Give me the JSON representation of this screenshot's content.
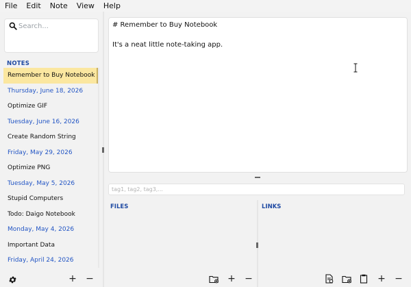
{
  "menu": [
    "File",
    "Edit",
    "Note",
    "View",
    "Help"
  ],
  "search": {
    "placeholder": "Search..."
  },
  "notes_heading": "NOTES",
  "notes": [
    {
      "label": "Remember to Buy Notebook",
      "kind": "selected"
    },
    {
      "label": "Thursday, June 18, 2026",
      "kind": "date"
    },
    {
      "label": "Optimize GIF",
      "kind": "note"
    },
    {
      "label": "Tuesday, June 16, 2026",
      "kind": "date"
    },
    {
      "label": "Create Random String",
      "kind": "note"
    },
    {
      "label": "Friday, May 29, 2026",
      "kind": "date"
    },
    {
      "label": "Optimize PNG",
      "kind": "note"
    },
    {
      "label": "Tuesday, May 5, 2026",
      "kind": "date"
    },
    {
      "label": "Stupid Computers",
      "kind": "note"
    },
    {
      "label": "Todo: Daigo Notebook",
      "kind": "note"
    },
    {
      "label": "Monday, May 4, 2026",
      "kind": "date"
    },
    {
      "label": "Important Data",
      "kind": "note"
    },
    {
      "label": "Friday, April 24, 2026",
      "kind": "date"
    }
  ],
  "editor": {
    "line1": "# Remember to Buy Notebook",
    "line2": "It's a neat little note-taking app."
  },
  "tags": {
    "placeholder": "tag1, tag2, tag3,..."
  },
  "files_heading": "FILES",
  "links_heading": "LINKS",
  "sidebar_footer": {
    "add_label": "+",
    "remove_label": "−"
  },
  "files_footer": {
    "add_label": "+",
    "remove_label": "−"
  },
  "links_footer": {
    "add_label": "+",
    "remove_label": "−"
  },
  "icons": {
    "search": "search-icon",
    "settings": "gear-icon",
    "folder": "folder-icon",
    "note_link": "note-link-icon",
    "clipboard": "clipboard-icon"
  },
  "colors": {
    "accent": "#1f4aa3",
    "date": "#2255c4",
    "selected_bg": "#fbe7a0"
  }
}
